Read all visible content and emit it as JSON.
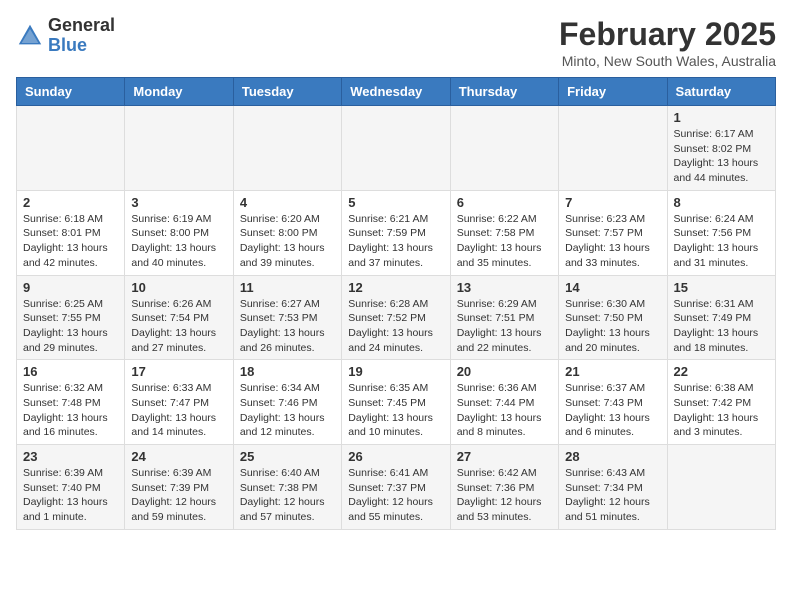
{
  "header": {
    "logo_general": "General",
    "logo_blue": "Blue",
    "month_title": "February 2025",
    "location": "Minto, New South Wales, Australia"
  },
  "days_of_week": [
    "Sunday",
    "Monday",
    "Tuesday",
    "Wednesday",
    "Thursday",
    "Friday",
    "Saturday"
  ],
  "weeks": [
    [
      {
        "day": "",
        "info": ""
      },
      {
        "day": "",
        "info": ""
      },
      {
        "day": "",
        "info": ""
      },
      {
        "day": "",
        "info": ""
      },
      {
        "day": "",
        "info": ""
      },
      {
        "day": "",
        "info": ""
      },
      {
        "day": "1",
        "info": "Sunrise: 6:17 AM\nSunset: 8:02 PM\nDaylight: 13 hours\nand 44 minutes."
      }
    ],
    [
      {
        "day": "2",
        "info": "Sunrise: 6:18 AM\nSunset: 8:01 PM\nDaylight: 13 hours\nand 42 minutes."
      },
      {
        "day": "3",
        "info": "Sunrise: 6:19 AM\nSunset: 8:00 PM\nDaylight: 13 hours\nand 40 minutes."
      },
      {
        "day": "4",
        "info": "Sunrise: 6:20 AM\nSunset: 8:00 PM\nDaylight: 13 hours\nand 39 minutes."
      },
      {
        "day": "5",
        "info": "Sunrise: 6:21 AM\nSunset: 7:59 PM\nDaylight: 13 hours\nand 37 minutes."
      },
      {
        "day": "6",
        "info": "Sunrise: 6:22 AM\nSunset: 7:58 PM\nDaylight: 13 hours\nand 35 minutes."
      },
      {
        "day": "7",
        "info": "Sunrise: 6:23 AM\nSunset: 7:57 PM\nDaylight: 13 hours\nand 33 minutes."
      },
      {
        "day": "8",
        "info": "Sunrise: 6:24 AM\nSunset: 7:56 PM\nDaylight: 13 hours\nand 31 minutes."
      }
    ],
    [
      {
        "day": "9",
        "info": "Sunrise: 6:25 AM\nSunset: 7:55 PM\nDaylight: 13 hours\nand 29 minutes."
      },
      {
        "day": "10",
        "info": "Sunrise: 6:26 AM\nSunset: 7:54 PM\nDaylight: 13 hours\nand 27 minutes."
      },
      {
        "day": "11",
        "info": "Sunrise: 6:27 AM\nSunset: 7:53 PM\nDaylight: 13 hours\nand 26 minutes."
      },
      {
        "day": "12",
        "info": "Sunrise: 6:28 AM\nSunset: 7:52 PM\nDaylight: 13 hours\nand 24 minutes."
      },
      {
        "day": "13",
        "info": "Sunrise: 6:29 AM\nSunset: 7:51 PM\nDaylight: 13 hours\nand 22 minutes."
      },
      {
        "day": "14",
        "info": "Sunrise: 6:30 AM\nSunset: 7:50 PM\nDaylight: 13 hours\nand 20 minutes."
      },
      {
        "day": "15",
        "info": "Sunrise: 6:31 AM\nSunset: 7:49 PM\nDaylight: 13 hours\nand 18 minutes."
      }
    ],
    [
      {
        "day": "16",
        "info": "Sunrise: 6:32 AM\nSunset: 7:48 PM\nDaylight: 13 hours\nand 16 minutes."
      },
      {
        "day": "17",
        "info": "Sunrise: 6:33 AM\nSunset: 7:47 PM\nDaylight: 13 hours\nand 14 minutes."
      },
      {
        "day": "18",
        "info": "Sunrise: 6:34 AM\nSunset: 7:46 PM\nDaylight: 13 hours\nand 12 minutes."
      },
      {
        "day": "19",
        "info": "Sunrise: 6:35 AM\nSunset: 7:45 PM\nDaylight: 13 hours\nand 10 minutes."
      },
      {
        "day": "20",
        "info": "Sunrise: 6:36 AM\nSunset: 7:44 PM\nDaylight: 13 hours\nand 8 minutes."
      },
      {
        "day": "21",
        "info": "Sunrise: 6:37 AM\nSunset: 7:43 PM\nDaylight: 13 hours\nand 6 minutes."
      },
      {
        "day": "22",
        "info": "Sunrise: 6:38 AM\nSunset: 7:42 PM\nDaylight: 13 hours\nand 3 minutes."
      }
    ],
    [
      {
        "day": "23",
        "info": "Sunrise: 6:39 AM\nSunset: 7:40 PM\nDaylight: 13 hours\nand 1 minute."
      },
      {
        "day": "24",
        "info": "Sunrise: 6:39 AM\nSunset: 7:39 PM\nDaylight: 12 hours\nand 59 minutes."
      },
      {
        "day": "25",
        "info": "Sunrise: 6:40 AM\nSunset: 7:38 PM\nDaylight: 12 hours\nand 57 minutes."
      },
      {
        "day": "26",
        "info": "Sunrise: 6:41 AM\nSunset: 7:37 PM\nDaylight: 12 hours\nand 55 minutes."
      },
      {
        "day": "27",
        "info": "Sunrise: 6:42 AM\nSunset: 7:36 PM\nDaylight: 12 hours\nand 53 minutes."
      },
      {
        "day": "28",
        "info": "Sunrise: 6:43 AM\nSunset: 7:34 PM\nDaylight: 12 hours\nand 51 minutes."
      },
      {
        "day": "",
        "info": ""
      }
    ]
  ]
}
